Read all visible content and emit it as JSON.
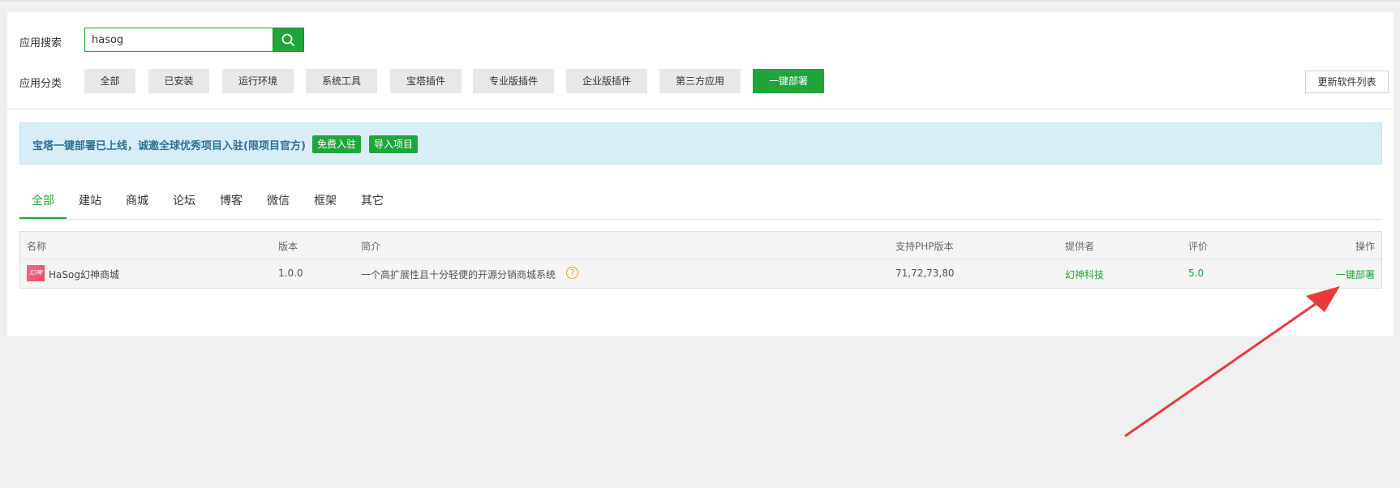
{
  "search": {
    "label": "应用搜索",
    "value": "hasog"
  },
  "category": {
    "label": "应用分类",
    "items": [
      "全部",
      "已安装",
      "运行环境",
      "系统工具",
      "宝塔插件",
      "专业版插件",
      "企业版插件",
      "第三方应用",
      "一键部署"
    ],
    "active_index": 8,
    "refresh_label": "更新软件列表"
  },
  "notice": {
    "text": "宝塔一键部署已上线，诚邀全球优秀项目入驻(限项目官方)",
    "btn_join": "免费入驻",
    "btn_import": "导入项目"
  },
  "tabs": {
    "items": [
      "全部",
      "建站",
      "商城",
      "论坛",
      "博客",
      "微信",
      "框架",
      "其它"
    ],
    "active_index": 0
  },
  "table": {
    "headers": [
      "名称",
      "版本",
      "简介",
      "支持PHP版本",
      "提供者",
      "评价",
      "操作"
    ],
    "rows": [
      {
        "name": "HaSog幻神商城",
        "version": "1.0.0",
        "desc": "一个高扩展性且十分轻便的开源分销商城系统",
        "php": "71,72,73,80",
        "provider": "幻神科技",
        "rating": "5.0",
        "action": "一键部署"
      }
    ]
  },
  "colors": {
    "accent": "#20a53a",
    "arrow": "#e83a3a",
    "notice_bg": "#d9edf7"
  },
  "icons": {
    "search": "search-icon",
    "help": "question-circle-icon",
    "app_logo": "hasog-logo-icon"
  }
}
